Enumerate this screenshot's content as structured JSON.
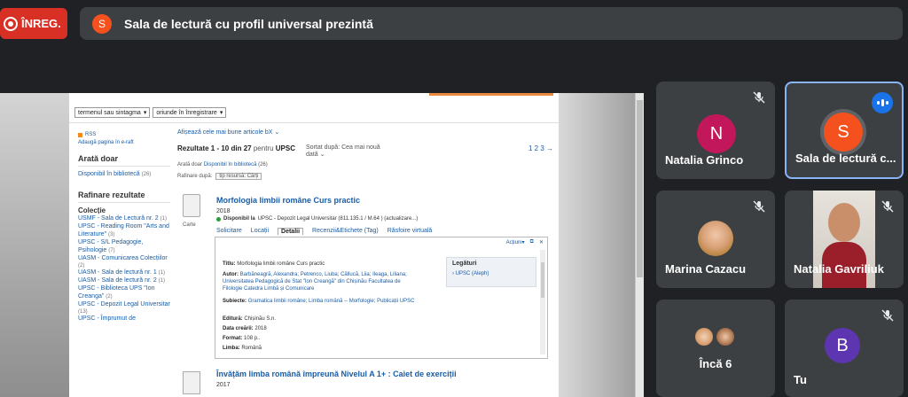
{
  "recording": {
    "label": "ÎNREG."
  },
  "presentation": {
    "avatar_letter": "S",
    "title": "Sala de lectură cu profil universal prezintă"
  },
  "webpage": {
    "filters": [
      "termenul sau sintagma",
      "oriunde în înregistrare"
    ],
    "rss": "RSS",
    "add_page": "Adaugă pagina în e-raft",
    "show_only_heading": "Arată doar",
    "available_link": "Disponibil în bibliotecă",
    "available_count": "(26)",
    "refine_heading": "Rafinare rezultate",
    "collection_heading": "Colecție",
    "collections": [
      {
        "label": "USMF - Sala de Lectură nr. 2",
        "count": "(1)"
      },
      {
        "label": "UPSC - Reading Room \"Arts and Literature\"",
        "count": "(3)"
      },
      {
        "label": "UPSC - S/L Pedagogie, Psihologie",
        "count": "(7)"
      },
      {
        "label": "UASM - Comunicarea Colecțiilor",
        "count": "(2)"
      },
      {
        "label": "UASM - Sala de lectură nr. 1",
        "count": "(1)"
      },
      {
        "label": "UASM - Sala de lectură nr. 2",
        "count": "(1)"
      },
      {
        "label": "UPSC - Biblioteca UPS \"Ion Creanga\"",
        "count": "(2)"
      },
      {
        "label": "UPSC - Depozit Legal Universitar",
        "count": "(13)"
      },
      {
        "label": "UPSC - Împrumut de",
        "count": ""
      }
    ],
    "best_articles": "Afișează cele mai bune articole bX",
    "results_text": "Rezultate 1 - 10 din",
    "results_total": "27",
    "results_for": "pentru",
    "results_query": "UPSC",
    "sort_label": "Sortat după:",
    "sort_value": "Cea mai nouă dată",
    "pager": "1 2 3 →",
    "show_only_small": "Arată doar",
    "show_only_small_link": "Disponibil în bibliotecă",
    "show_only_small_count": "(26)",
    "refine_by": "Rafinare după:",
    "refine_tag": "tip resursă: Cărți",
    "record1": {
      "icon_label": "Carte",
      "title": "Morfologia limbii române Curs practic",
      "year": "2018",
      "avail_strong": "Disponibil la",
      "avail_rest": "UPSC - Depozit Legal Universitar   (811.135.1 / M.64 ) (actualizare...)",
      "tabs": [
        "Solicitare",
        "Locații",
        "Detalii",
        "Recenzii&Etichete (Tag)",
        "Răsfoire virtuală"
      ],
      "actions": [
        "Acțiuni▾",
        "⧉",
        "✕"
      ],
      "rows": [
        {
          "k": "Titlu:",
          "v": "Morfologia limbii române Curs practic"
        },
        {
          "k": "Autor:",
          "v": "Barbăneagră, Alexandra; Petrenco, Liuba; Căllucă, Liia; Ileaga, Liliana; Universitatea Pedagogică de Stat \"Ion Creangă\" din Chișinău Facultatea de Filologie Catedra Limbă și Comunicare"
        },
        {
          "k": "Subiecte:",
          "v": "Gramatica limbii române; Limba română -- Morfologie; Publicații UPSC"
        },
        {
          "k": "Editură:",
          "v": "Chișinău S.n."
        },
        {
          "k": "Data creării:",
          "v": "2018"
        },
        {
          "k": "Format:",
          "v": "108 p.."
        },
        {
          "k": "Limba:",
          "v": "Română"
        }
      ],
      "links_title": "Legături",
      "links_item": "› UPSC (Aleph)"
    },
    "record2": {
      "title": "Învățăm limba română împreună Nivelul A 1+ : Caiet de exerciții",
      "year": "2017"
    }
  },
  "participants": [
    {
      "name": "Natalia Grinco",
      "avatar": "N",
      "color": "#c2185b",
      "muted": true
    },
    {
      "name": "Sala de lectură c...",
      "avatar": "S",
      "color": "#f4511e",
      "speaking": true
    },
    {
      "name": "Marina Cazacu",
      "muted": true
    },
    {
      "name": "Natalia Gavriliuk",
      "muted": true
    },
    {
      "name": "Încă 6"
    },
    {
      "name": "Tu",
      "avatar": "B",
      "color": "#5e35b1",
      "muted": true
    }
  ]
}
